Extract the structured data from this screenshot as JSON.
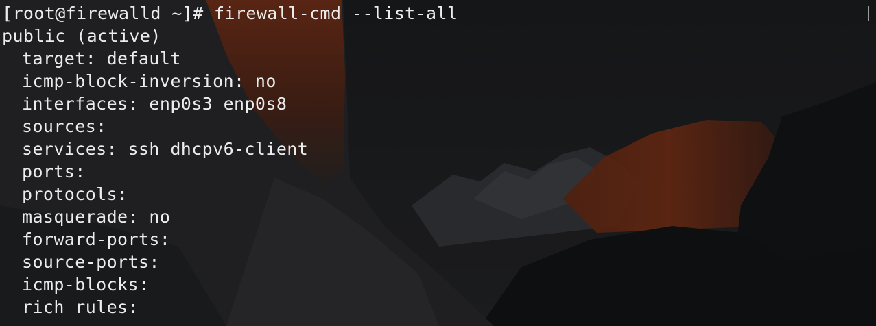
{
  "terminal": {
    "prompt": "[root@firewalld ~]# ",
    "command": "firewall-cmd --list-all",
    "zone_header": "public (active)",
    "lines": [
      "target: default",
      "icmp-block-inversion: no",
      "interfaces: enp0s3 enp0s8",
      "sources:",
      "services: ssh dhcpv6-client",
      "ports:",
      "protocols:",
      "masquerade: no",
      "forward-ports:",
      "source-ports:",
      "icmp-blocks:",
      "rich rules:"
    ]
  },
  "colors": {
    "text": "#ececec",
    "background": "#1c1d1f",
    "rock_glow": "#b4421a"
  }
}
